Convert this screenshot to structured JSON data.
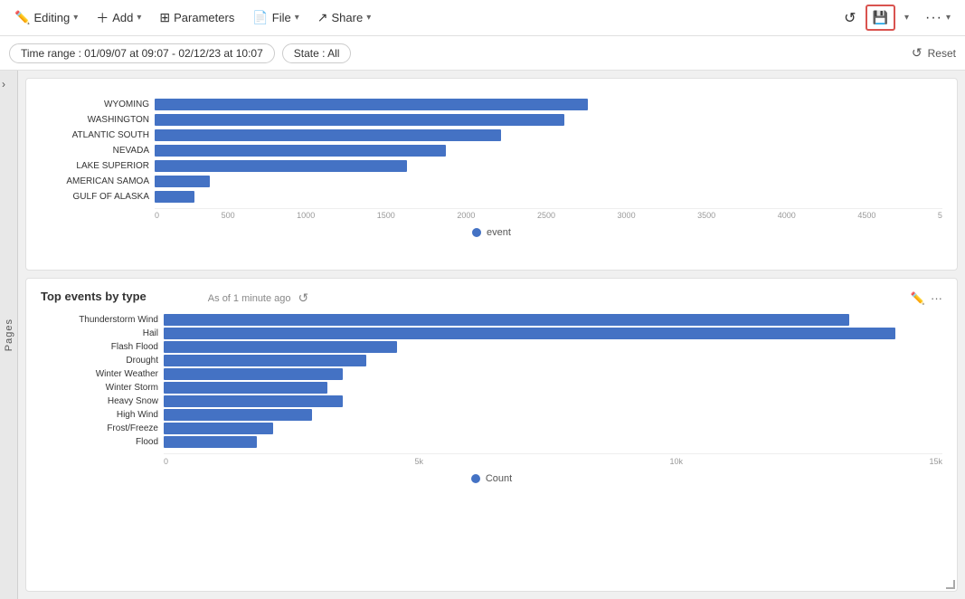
{
  "toolbar": {
    "editing_label": "Editing",
    "add_label": "Add",
    "parameters_label": "Parameters",
    "file_label": "File",
    "share_label": "Share"
  },
  "filter_bar": {
    "time_range": "Time range : 01/09/07 at 09:07 - 02/12/23 at 10:07",
    "state": "State : All",
    "reset_label": "Reset"
  },
  "pages_sidebar": {
    "label": "Pages",
    "arrow": "›"
  },
  "top_chart": {
    "x_axis_labels": [
      "0",
      "500",
      "1000",
      "1500",
      "2000",
      "2500",
      "3000",
      "3500",
      "4000",
      "4500",
      "5"
    ],
    "legend": "event",
    "rows": [
      {
        "label": "WYOMING",
        "value": 55,
        "max": 100
      },
      {
        "label": "WASHINGTON",
        "value": 52,
        "max": 100
      },
      {
        "label": "ATLANTIC SOUTH",
        "value": 44,
        "max": 100
      },
      {
        "label": "NEVADA",
        "value": 39,
        "max": 100
      },
      {
        "label": "LAKE SUPERIOR",
        "value": 35,
        "max": 100
      },
      {
        "label": "AMERICAN SAMOA",
        "value": 10,
        "max": 100
      },
      {
        "label": "GULF OF ALASKA",
        "value": 8,
        "max": 100
      }
    ]
  },
  "bottom_chart": {
    "title": "Top events by type",
    "as_of": "As of 1 minute ago",
    "legend": "Count",
    "x_axis_labels": [
      "0",
      "5k",
      "10k",
      "15k"
    ],
    "rows": [
      {
        "label": "Thunderstorm Wind",
        "value": 88,
        "display": "~14k"
      },
      {
        "label": "Hail",
        "value": 92,
        "display": "~15k"
      },
      {
        "label": "Flash Flood",
        "value": 30,
        "display": "~5k"
      },
      {
        "label": "Drought",
        "value": 27,
        "display": "~4k"
      },
      {
        "label": "Winter Weather",
        "value": 24,
        "display": "~4k"
      },
      {
        "label": "Winter Storm",
        "value": 22,
        "display": "~3.5k"
      },
      {
        "label": "Heavy Snow",
        "value": 24,
        "display": "~4k"
      },
      {
        "label": "High Wind",
        "value": 20,
        "display": "~3k"
      },
      {
        "label": "Frost/Freeze",
        "value": 15,
        "display": "~2.5k"
      },
      {
        "label": "Flood",
        "value": 13,
        "display": "~2k"
      }
    ]
  }
}
